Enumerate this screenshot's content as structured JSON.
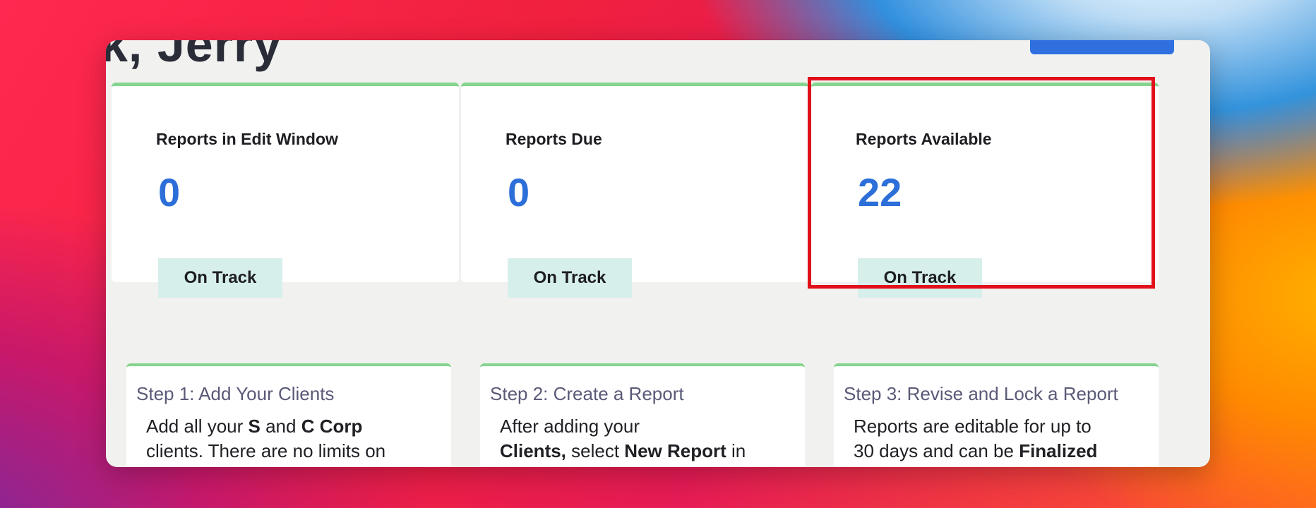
{
  "header": {
    "greeting": "k, Jerry"
  },
  "stats": [
    {
      "title": "Reports in Edit Window",
      "value": "0",
      "status": "On Track"
    },
    {
      "title": "Reports Due",
      "value": "0",
      "status": "On Track"
    },
    {
      "title": "Reports Available",
      "value": "22",
      "status": "On Track"
    }
  ],
  "steps": [
    {
      "title": "Step 1: Add Your Clients",
      "body": {
        "p1": "Add all your ",
        "b1": "S",
        "p2": " and ",
        "b2": "C Corp",
        "p3": "clients. There are no limits on"
      }
    },
    {
      "title": "Step 2: Create a Report",
      "body": {
        "p1": "After adding your",
        "b1": "Clients,",
        "p2": " select ",
        "b2": "New Report",
        "p3": " in"
      }
    },
    {
      "title": "Step 3: Revise and Lock a Report",
      "body": {
        "p1": "Reports are editable for up to",
        "p2": "30 days and can be ",
        "b1": "Finalized"
      }
    }
  ],
  "colors": {
    "accent_blue": "#2d6fd9",
    "card_top_border": "#85d48f",
    "badge_bg": "#d6efeb",
    "highlight": "#e2101a"
  }
}
